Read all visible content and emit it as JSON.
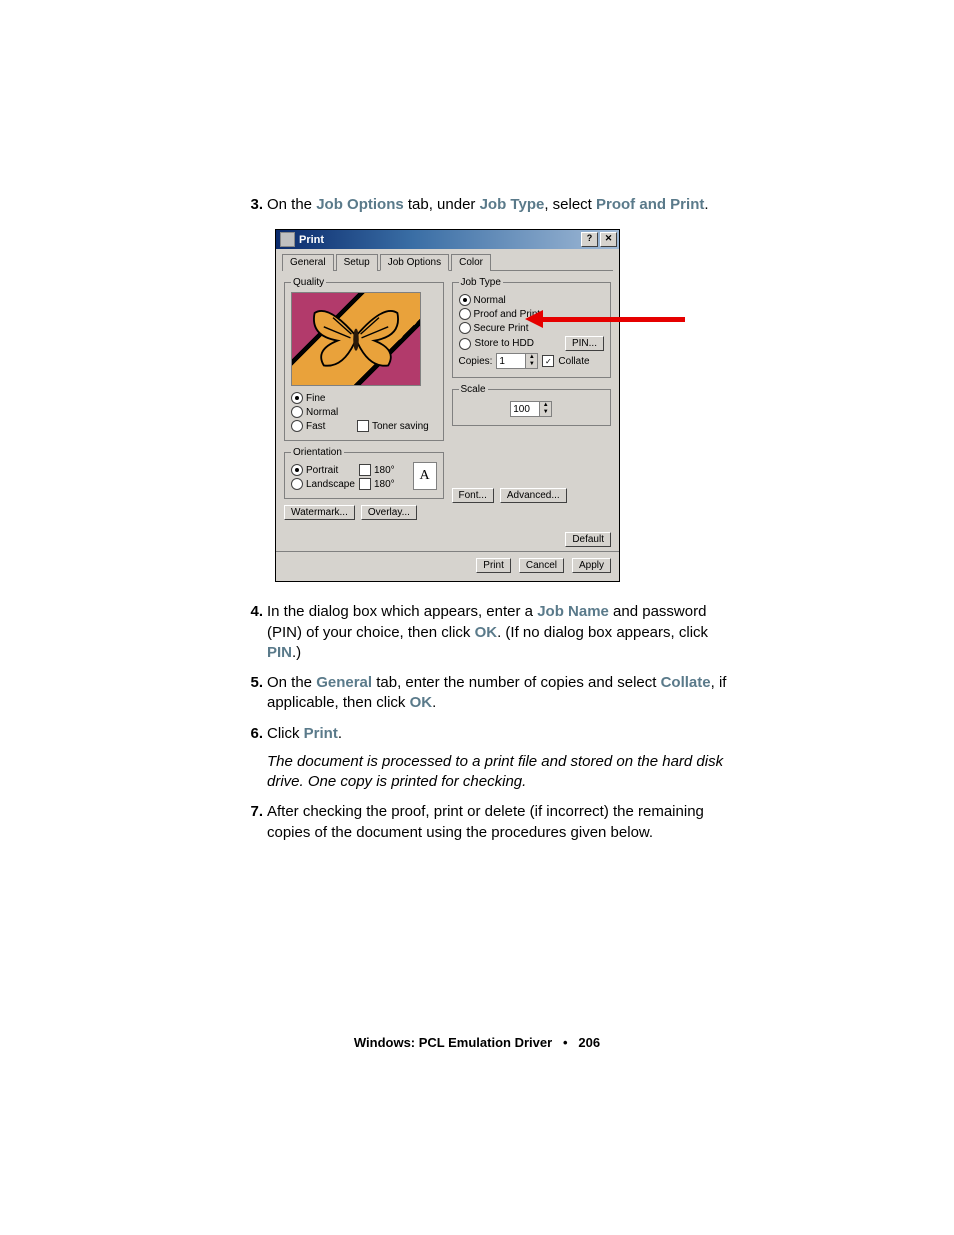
{
  "steps": {
    "s3": {
      "num": "3.",
      "on_the": "On the ",
      "tab": "Job Options",
      "mid": " tab, under ",
      "under": "Job Type",
      "sel": ", select ",
      "opt": "Proof and Print",
      "end": "."
    },
    "s4": {
      "num": "4.",
      "a": "In the dialog box which appears, enter a ",
      "jobname": "Job Name",
      "b": " and password (PIN) of your choice, then click ",
      "ok": "OK",
      "c": ". (If no dialog box appears, click ",
      "pin": "PIN",
      "d": ".)"
    },
    "s5": {
      "num": "5.",
      "a": "On the ",
      "gen": "General",
      "b": " tab, enter the number of copies and select ",
      "collate": "Collate",
      "c": ", if applicable, then click ",
      "ok": "OK",
      "d": "."
    },
    "s6": {
      "num": "6.",
      "a": "Click ",
      "print": "Print",
      "b": ".",
      "note": "The document is processed to a print file and stored on the hard disk drive. One copy is printed for checking."
    },
    "s7": {
      "num": "7.",
      "a": "After checking the proof, print or delete (if incorrect) the remaining copies of the document using the procedures given below."
    }
  },
  "dialog": {
    "title": "Print",
    "help": "?",
    "close": "✕",
    "tabs": {
      "general": "General",
      "setup": "Setup",
      "job": "Job Options",
      "color": "Color"
    },
    "quality": {
      "legend": "Quality",
      "fine": "Fine",
      "normal": "Normal",
      "fast": "Fast",
      "toner": "Toner saving"
    },
    "orientation": {
      "legend": "Orientation",
      "portrait": "Portrait",
      "r180a": "180°",
      "landscape": "Landscape",
      "r180b": "180°",
      "icon": "A"
    },
    "jobtype": {
      "legend": "Job Type",
      "normal": "Normal",
      "proof": "Proof and Print",
      "secure": "Secure Print",
      "store": "Store to HDD",
      "pin": "PIN...",
      "copies": "Copies:",
      "copies_val": "1",
      "collate": "Collate"
    },
    "scale": {
      "legend": "Scale",
      "val": "100"
    },
    "buttons": {
      "watermark": "Watermark...",
      "overlay": "Overlay...",
      "font": "Font...",
      "advanced": "Advanced...",
      "default": "Default",
      "print": "Print",
      "cancel": "Cancel",
      "apply": "Apply"
    }
  },
  "footer": {
    "text": "Windows: PCL Emulation Driver",
    "sep": "•",
    "page": "206"
  }
}
